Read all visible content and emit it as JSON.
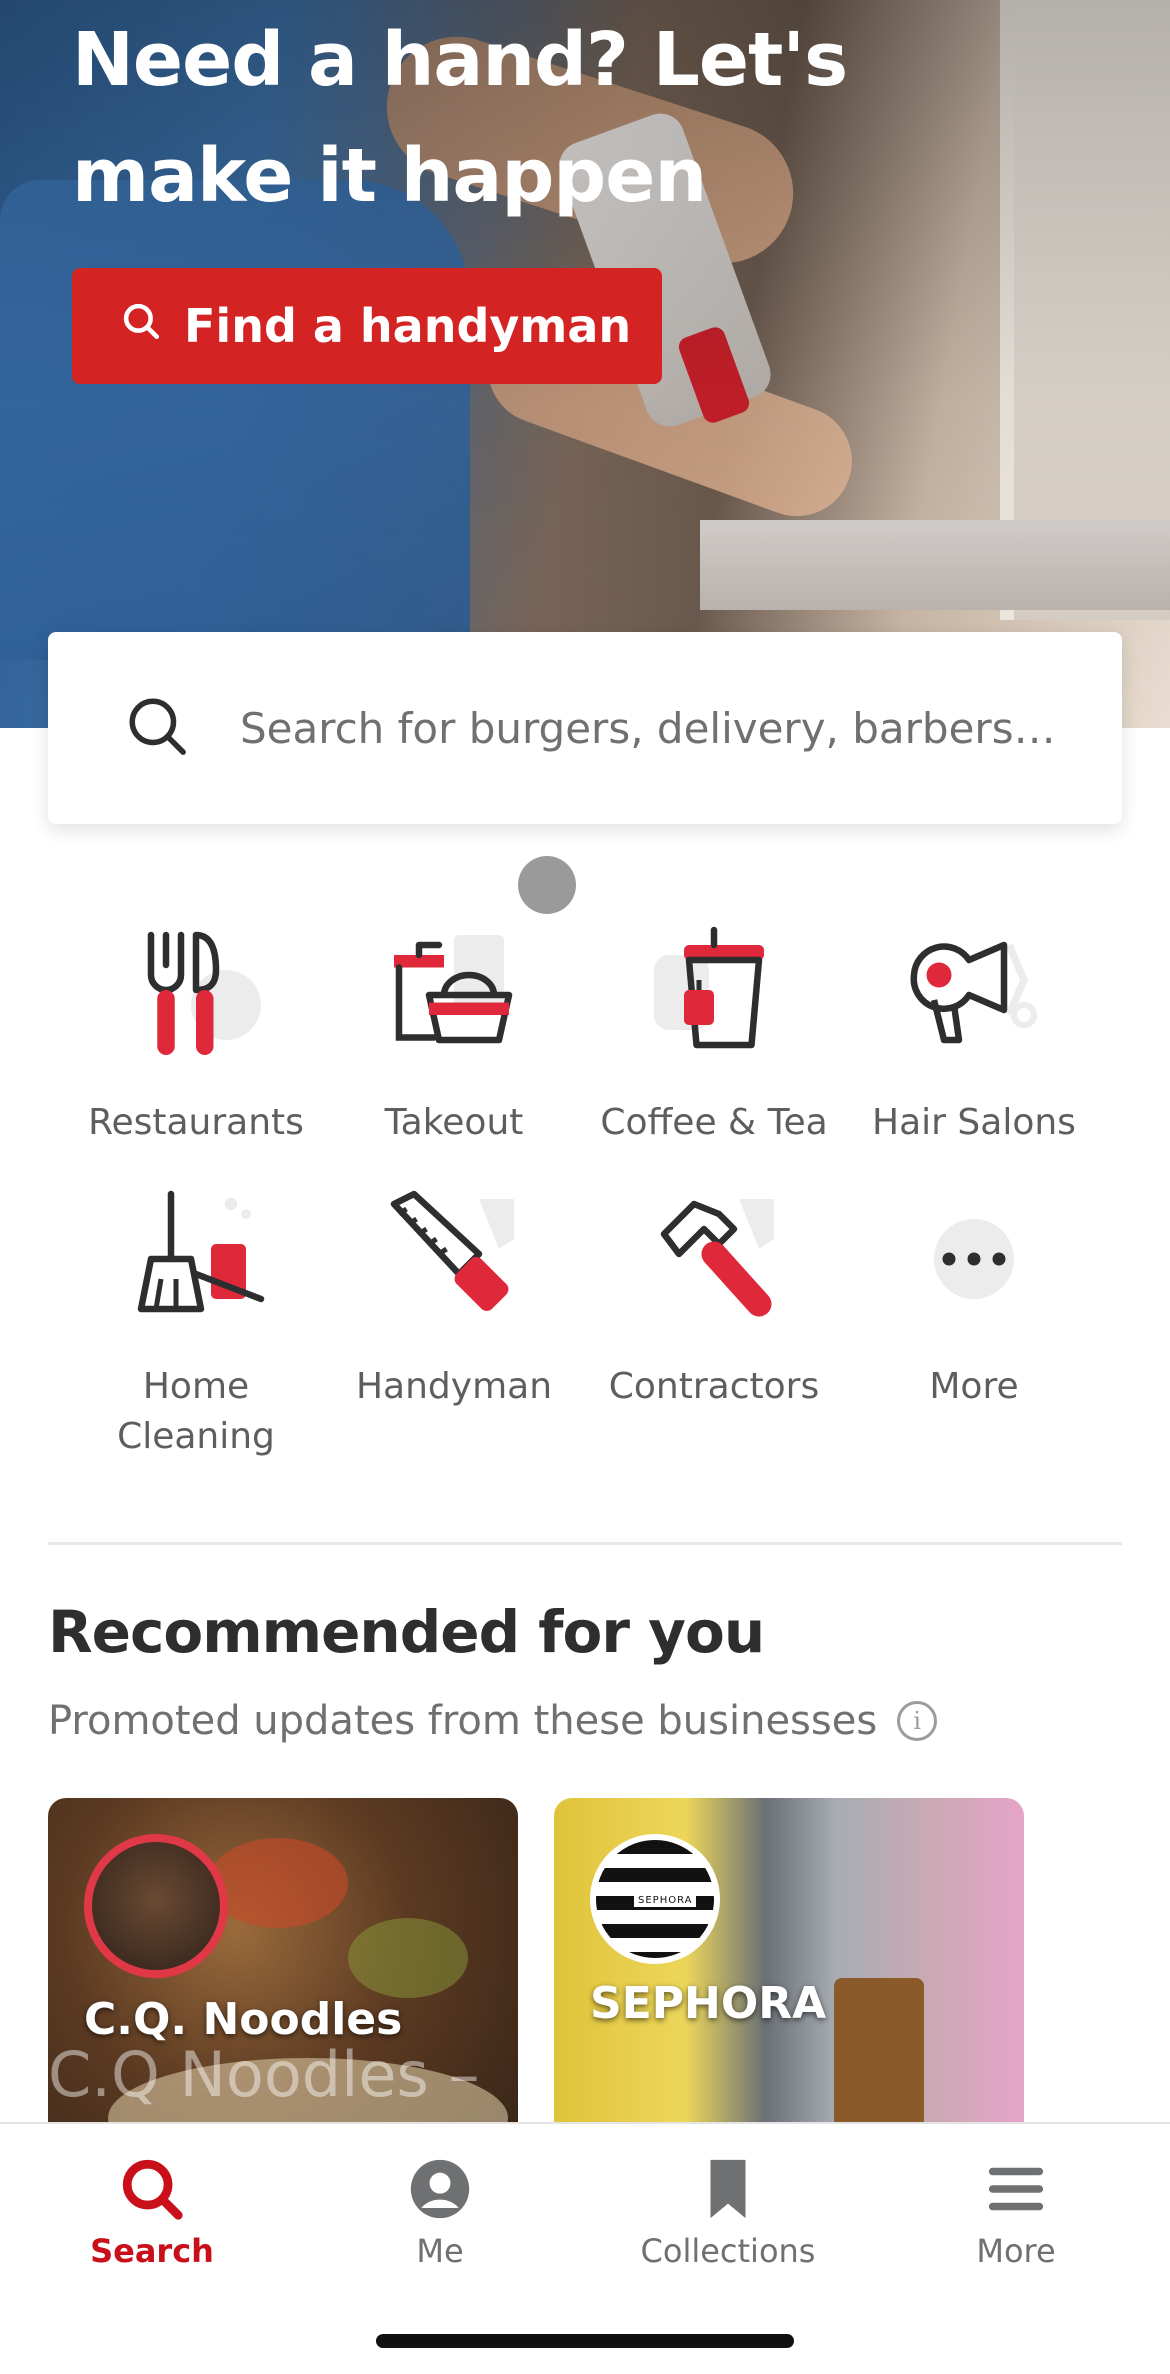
{
  "hero": {
    "title_line1": "Need a hand? Let's",
    "title_line2": "make it happen",
    "cta_label": "Find a handyman"
  },
  "search": {
    "placeholder": "Search for burgers, delivery, barbers on..."
  },
  "categories": [
    {
      "label": "Restaurants",
      "icon": "fork-knife-icon"
    },
    {
      "label": "Takeout",
      "icon": "takeout-basket-icon"
    },
    {
      "label": "Coffee & Tea",
      "icon": "coffee-cup-icon"
    },
    {
      "label": "Hair Salons",
      "icon": "hair-dryer-icon"
    },
    {
      "label": "Home Cleaning",
      "icon": "broom-icon"
    },
    {
      "label": "Handyman",
      "icon": "saw-icon"
    },
    {
      "label": "Contractors",
      "icon": "hammer-icon"
    },
    {
      "label": "More",
      "icon": "more-dots-icon"
    }
  ],
  "recommended": {
    "title": "Recommended for you",
    "subtitle": "Promoted updates from these businesses",
    "cards": [
      {
        "name": "C.Q. Noodles",
        "ghost_text": "C.Q Noodles –"
      },
      {
        "name": "SEPHORA",
        "logo_text": "SEPHORA"
      }
    ]
  },
  "tabbar": {
    "items": [
      {
        "label": "Search",
        "icon": "search-icon",
        "active": true
      },
      {
        "label": "Me",
        "icon": "user-icon",
        "active": false
      },
      {
        "label": "Collections",
        "icon": "bookmark-icon",
        "active": false
      },
      {
        "label": "More",
        "icon": "menu-icon",
        "active": false
      }
    ]
  },
  "colors": {
    "brand_red": "#d32323",
    "active_tab_red": "#c9101a"
  }
}
